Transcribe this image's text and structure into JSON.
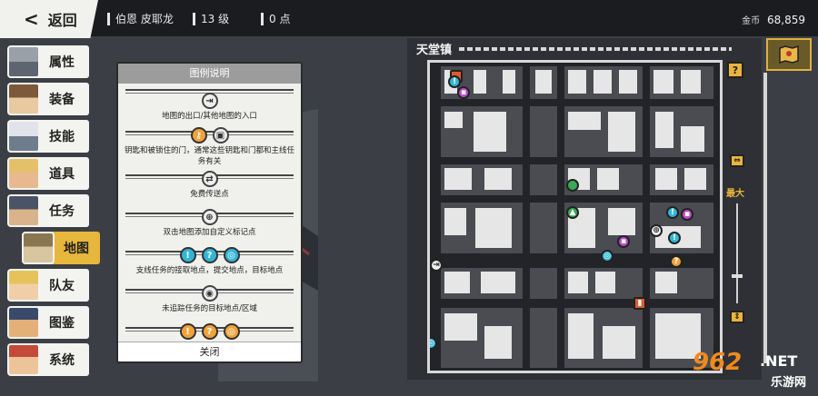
{
  "topbar": {
    "back_label": "返回",
    "player_name": "伯恩 皮耶龙",
    "level": "13 级",
    "points": "0 点",
    "coins_label": "金币",
    "coins_value": "68,859"
  },
  "sidebar": {
    "items": [
      {
        "label": "属性",
        "icon": "character-portrait-gray"
      },
      {
        "label": "装备",
        "icon": "character-portrait-brown"
      },
      {
        "label": "技能",
        "icon": "character-portrait-white"
      },
      {
        "label": "道具",
        "icon": "character-portrait-blonde"
      },
      {
        "label": "任务",
        "icon": "character-portrait-glasses"
      },
      {
        "label": "地图",
        "icon": "character-portrait-helmet",
        "active": true
      },
      {
        "label": "队友",
        "icon": "character-portrait-yellow"
      },
      {
        "label": "图鉴",
        "icon": "character-portrait-beard"
      },
      {
        "label": "系统",
        "icon": "character-portrait-red"
      }
    ]
  },
  "legend": {
    "title": "图例说明",
    "entries": [
      {
        "text": "地图的出口/其他地图的入口",
        "icons": [
          "exit-icon"
        ]
      },
      {
        "text": "钥匙和被锁住的门，通常这些钥匙和门都和主线任务有关",
        "icons": [
          "key-icon",
          "lock-icon"
        ]
      },
      {
        "text": "免费传送点",
        "icons": [
          "teleport-icon"
        ]
      },
      {
        "text": "双击地图添加自定义标记点",
        "icons": [
          "crosshair-icon"
        ]
      },
      {
        "text": "支线任务的接取地点，提交地点，目标地点",
        "icons": [
          "exclaim-icon",
          "question-icon",
          "target-icon"
        ]
      },
      {
        "text": "未追踪任务的目标地点/区域",
        "icons": [
          "pin-icon"
        ]
      }
    ],
    "close_label": "关闭"
  },
  "map": {
    "title": "天堂镇",
    "zoom_label": "最大",
    "help_label": "?"
  },
  "watermark": {
    "number": "962",
    "domain": ".NET",
    "site": "乐游网"
  }
}
